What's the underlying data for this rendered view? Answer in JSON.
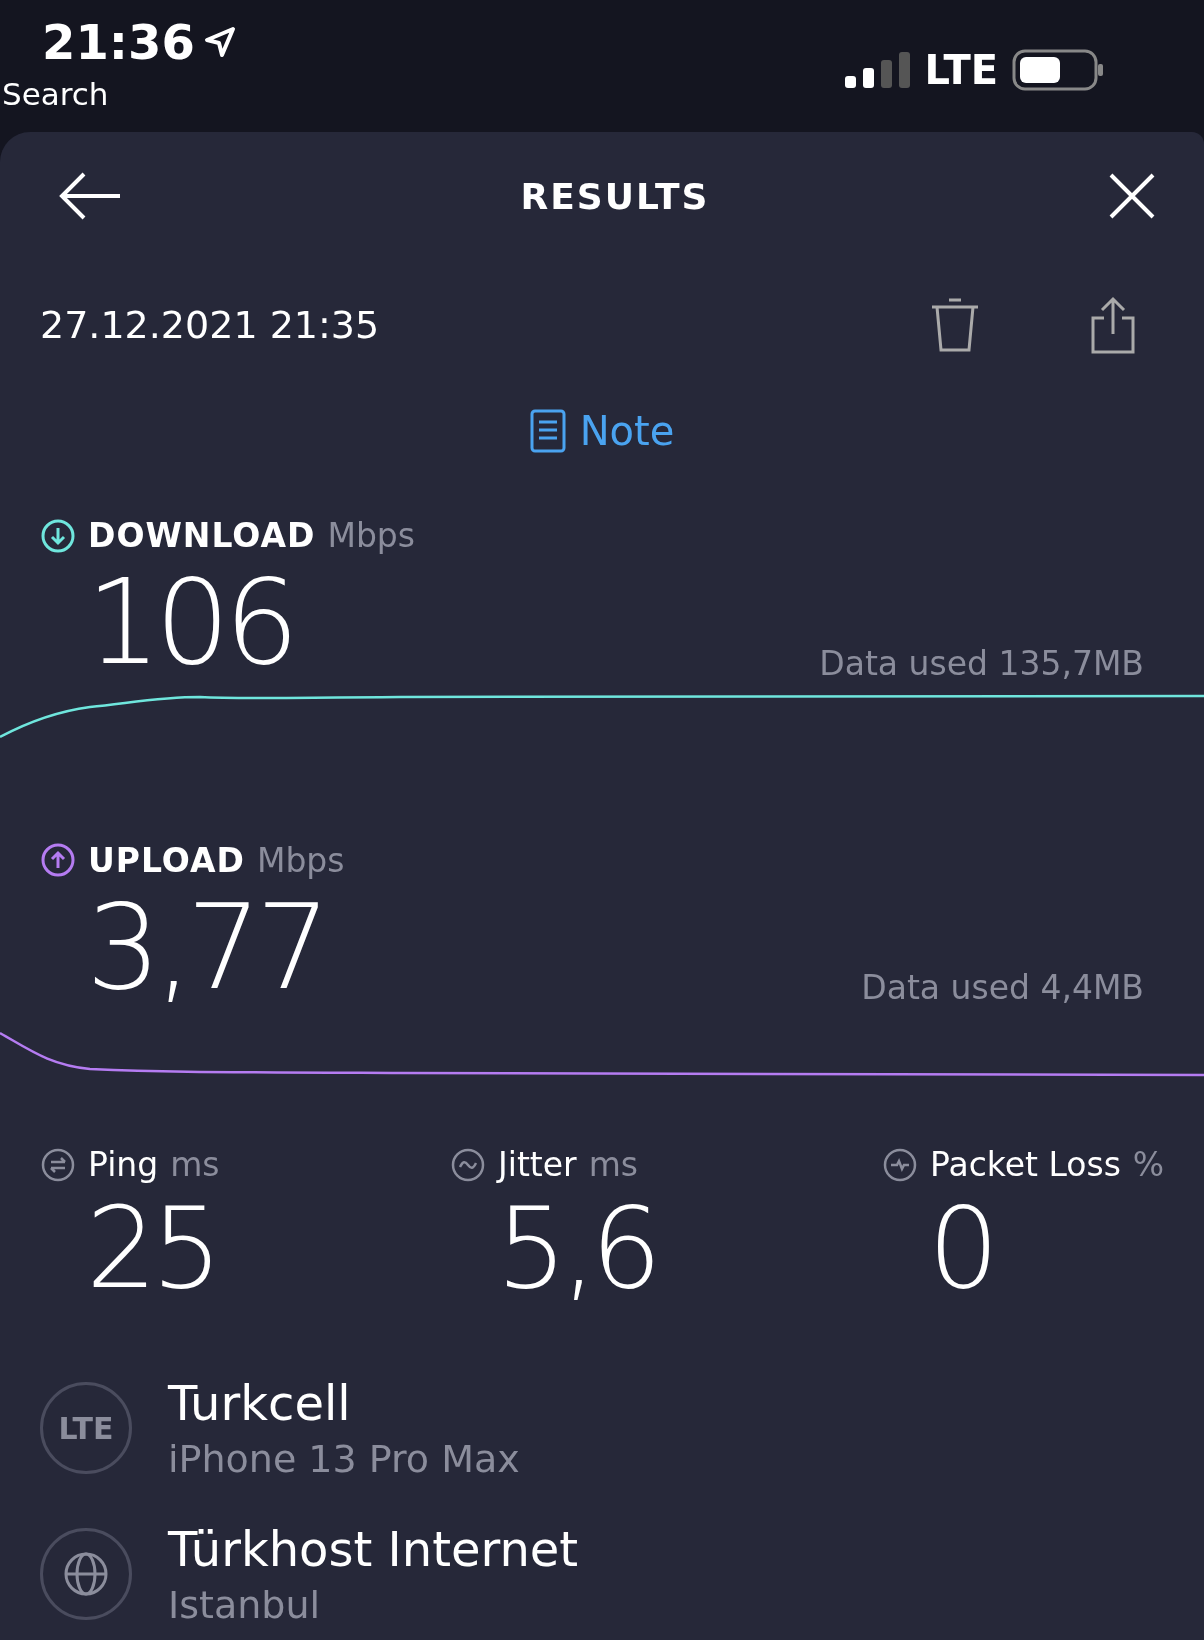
{
  "status_bar": {
    "time": "21:36",
    "back_label": "Search",
    "network": "LTE"
  },
  "header": {
    "title": "RESULTS"
  },
  "result": {
    "date": "27.12.2021 21:35",
    "note": "Note"
  },
  "download": {
    "label": "DOWNLOAD",
    "unit": "Mbps",
    "value": "106",
    "data_used": "Data used 135,7MB"
  },
  "upload": {
    "label": "UPLOAD",
    "unit": "Mbps",
    "value": "3,77",
    "data_used": "Data used 4,4MB"
  },
  "metrics": [
    {
      "kind": "ping",
      "label": "Ping",
      "unit": "ms",
      "value": "25"
    },
    {
      "kind": "jitter",
      "label": "Jitter",
      "unit": "ms",
      "value": "5,6"
    },
    {
      "kind": "loss",
      "label": "Packet Loss",
      "unit": "%",
      "value": "0"
    }
  ],
  "provider": {
    "badge": "LTE",
    "name": "Turkcell",
    "device": "iPhone 13 Pro Max"
  },
  "server": {
    "name": "Türkhost Internet",
    "location": "Istanbul"
  }
}
